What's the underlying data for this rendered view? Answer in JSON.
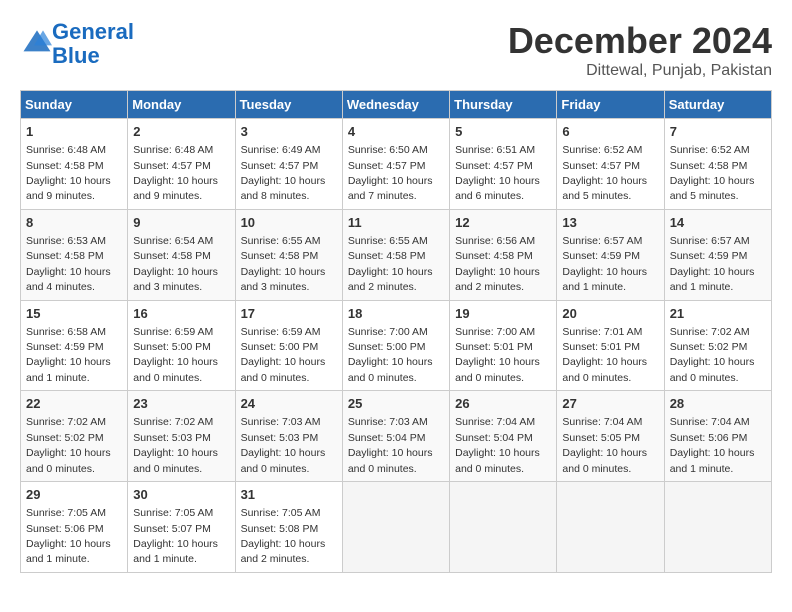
{
  "header": {
    "logo_general": "General",
    "logo_blue": "Blue",
    "month": "December 2024",
    "location": "Dittewal, Punjab, Pakistan"
  },
  "days_of_week": [
    "Sunday",
    "Monday",
    "Tuesday",
    "Wednesday",
    "Thursday",
    "Friday",
    "Saturday"
  ],
  "weeks": [
    [
      {
        "day": 1,
        "sunrise": "6:48 AM",
        "sunset": "4:58 PM",
        "daylight": "10 hours and 9 minutes."
      },
      {
        "day": 2,
        "sunrise": "6:48 AM",
        "sunset": "4:57 PM",
        "daylight": "10 hours and 9 minutes."
      },
      {
        "day": 3,
        "sunrise": "6:49 AM",
        "sunset": "4:57 PM",
        "daylight": "10 hours and 8 minutes."
      },
      {
        "day": 4,
        "sunrise": "6:50 AM",
        "sunset": "4:57 PM",
        "daylight": "10 hours and 7 minutes."
      },
      {
        "day": 5,
        "sunrise": "6:51 AM",
        "sunset": "4:57 PM",
        "daylight": "10 hours and 6 minutes."
      },
      {
        "day": 6,
        "sunrise": "6:52 AM",
        "sunset": "4:57 PM",
        "daylight": "10 hours and 5 minutes."
      },
      {
        "day": 7,
        "sunrise": "6:52 AM",
        "sunset": "4:58 PM",
        "daylight": "10 hours and 5 minutes."
      }
    ],
    [
      {
        "day": 8,
        "sunrise": "6:53 AM",
        "sunset": "4:58 PM",
        "daylight": "10 hours and 4 minutes."
      },
      {
        "day": 9,
        "sunrise": "6:54 AM",
        "sunset": "4:58 PM",
        "daylight": "10 hours and 3 minutes."
      },
      {
        "day": 10,
        "sunrise": "6:55 AM",
        "sunset": "4:58 PM",
        "daylight": "10 hours and 3 minutes."
      },
      {
        "day": 11,
        "sunrise": "6:55 AM",
        "sunset": "4:58 PM",
        "daylight": "10 hours and 2 minutes."
      },
      {
        "day": 12,
        "sunrise": "6:56 AM",
        "sunset": "4:58 PM",
        "daylight": "10 hours and 2 minutes."
      },
      {
        "day": 13,
        "sunrise": "6:57 AM",
        "sunset": "4:59 PM",
        "daylight": "10 hours and 1 minute."
      },
      {
        "day": 14,
        "sunrise": "6:57 AM",
        "sunset": "4:59 PM",
        "daylight": "10 hours and 1 minute."
      }
    ],
    [
      {
        "day": 15,
        "sunrise": "6:58 AM",
        "sunset": "4:59 PM",
        "daylight": "10 hours and 1 minute."
      },
      {
        "day": 16,
        "sunrise": "6:59 AM",
        "sunset": "5:00 PM",
        "daylight": "10 hours and 0 minutes."
      },
      {
        "day": 17,
        "sunrise": "6:59 AM",
        "sunset": "5:00 PM",
        "daylight": "10 hours and 0 minutes."
      },
      {
        "day": 18,
        "sunrise": "7:00 AM",
        "sunset": "5:00 PM",
        "daylight": "10 hours and 0 minutes."
      },
      {
        "day": 19,
        "sunrise": "7:00 AM",
        "sunset": "5:01 PM",
        "daylight": "10 hours and 0 minutes."
      },
      {
        "day": 20,
        "sunrise": "7:01 AM",
        "sunset": "5:01 PM",
        "daylight": "10 hours and 0 minutes."
      },
      {
        "day": 21,
        "sunrise": "7:02 AM",
        "sunset": "5:02 PM",
        "daylight": "10 hours and 0 minutes."
      }
    ],
    [
      {
        "day": 22,
        "sunrise": "7:02 AM",
        "sunset": "5:02 PM",
        "daylight": "10 hours and 0 minutes."
      },
      {
        "day": 23,
        "sunrise": "7:02 AM",
        "sunset": "5:03 PM",
        "daylight": "10 hours and 0 minutes."
      },
      {
        "day": 24,
        "sunrise": "7:03 AM",
        "sunset": "5:03 PM",
        "daylight": "10 hours and 0 minutes."
      },
      {
        "day": 25,
        "sunrise": "7:03 AM",
        "sunset": "5:04 PM",
        "daylight": "10 hours and 0 minutes."
      },
      {
        "day": 26,
        "sunrise": "7:04 AM",
        "sunset": "5:04 PM",
        "daylight": "10 hours and 0 minutes."
      },
      {
        "day": 27,
        "sunrise": "7:04 AM",
        "sunset": "5:05 PM",
        "daylight": "10 hours and 0 minutes."
      },
      {
        "day": 28,
        "sunrise": "7:04 AM",
        "sunset": "5:06 PM",
        "daylight": "10 hours and 1 minute."
      }
    ],
    [
      {
        "day": 29,
        "sunrise": "7:05 AM",
        "sunset": "5:06 PM",
        "daylight": "10 hours and 1 minute."
      },
      {
        "day": 30,
        "sunrise": "7:05 AM",
        "sunset": "5:07 PM",
        "daylight": "10 hours and 1 minute."
      },
      {
        "day": 31,
        "sunrise": "7:05 AM",
        "sunset": "5:08 PM",
        "daylight": "10 hours and 2 minutes."
      },
      null,
      null,
      null,
      null
    ]
  ]
}
